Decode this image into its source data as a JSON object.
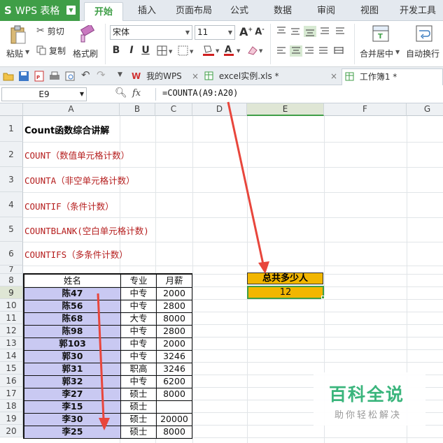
{
  "app": {
    "name": "WPS 表格",
    "logo": "S"
  },
  "menu_tabs": [
    {
      "label": "开始",
      "active": true
    },
    {
      "label": "插入"
    },
    {
      "label": "页面布局"
    },
    {
      "label": "公式"
    },
    {
      "label": "数据"
    },
    {
      "label": "审阅"
    },
    {
      "label": "视图"
    },
    {
      "label": "开发工具"
    }
  ],
  "ribbon": {
    "paste": "粘贴",
    "cut": "剪切",
    "copy": "复制",
    "format_painter": "格式刷",
    "font_name": "宋体",
    "font_size": "11",
    "bold": "B",
    "italic": "I",
    "underline": "U",
    "merge_center": "合并居中",
    "wrap_text": "自动换行"
  },
  "doc_tabs": [
    {
      "label": "我的WPS"
    },
    {
      "label": "excel实例.xls *"
    },
    {
      "label": "工作簿1 *",
      "active": true
    }
  ],
  "formula_bar": {
    "cell_ref": "E9",
    "fx": "fx",
    "formula": "=COUNTA(A9:A20)"
  },
  "columns": [
    "A",
    "B",
    "C",
    "D",
    "E",
    "F",
    "G"
  ],
  "rows": [
    "1",
    "2",
    "3",
    "4",
    "5",
    "6",
    "7",
    "8",
    "9",
    "10",
    "11",
    "12",
    "13",
    "14",
    "15",
    "16",
    "17",
    "18",
    "19",
    "20"
  ],
  "notes": {
    "title": "Count函数综合讲解",
    "items": [
      "COUNT（数值单元格计数）",
      "COUNTA（非空单元格计数）",
      "COUNTIF（条件计数）",
      "COUNTBLANK(空白单元格计数)",
      "COUNTIFS（多条件计数）"
    ]
  },
  "table": {
    "headers": [
      "姓名",
      "专业",
      "月薪"
    ],
    "rows": [
      [
        "陈47",
        "中专",
        "2000"
      ],
      [
        "陈56",
        "中专",
        "2800"
      ],
      [
        "陈68",
        "大专",
        "8000"
      ],
      [
        "陈98",
        "中专",
        "2800"
      ],
      [
        "郭103",
        "中专",
        "2000"
      ],
      [
        "郭30",
        "中专",
        "3246"
      ],
      [
        "郭31",
        "职高",
        "3246"
      ],
      [
        "郭32",
        "中专",
        "6200"
      ],
      [
        "李27",
        "硕士",
        "8000"
      ],
      [
        "李15",
        "硕士",
        ""
      ],
      [
        "李30",
        "硕士",
        "20000"
      ],
      [
        "李25",
        "硕士",
        "8000"
      ]
    ]
  },
  "result": {
    "label": "总共多少人",
    "value": "12"
  },
  "watermark": {
    "title": "百科全说",
    "subtitle": "助你轻松解决"
  },
  "colors": {
    "accent": "#3f9e47",
    "highlight": "#f2b600",
    "name_fill": "#c9c9f2",
    "note_red": "#b51d1d",
    "arrow": "#e8463c"
  }
}
